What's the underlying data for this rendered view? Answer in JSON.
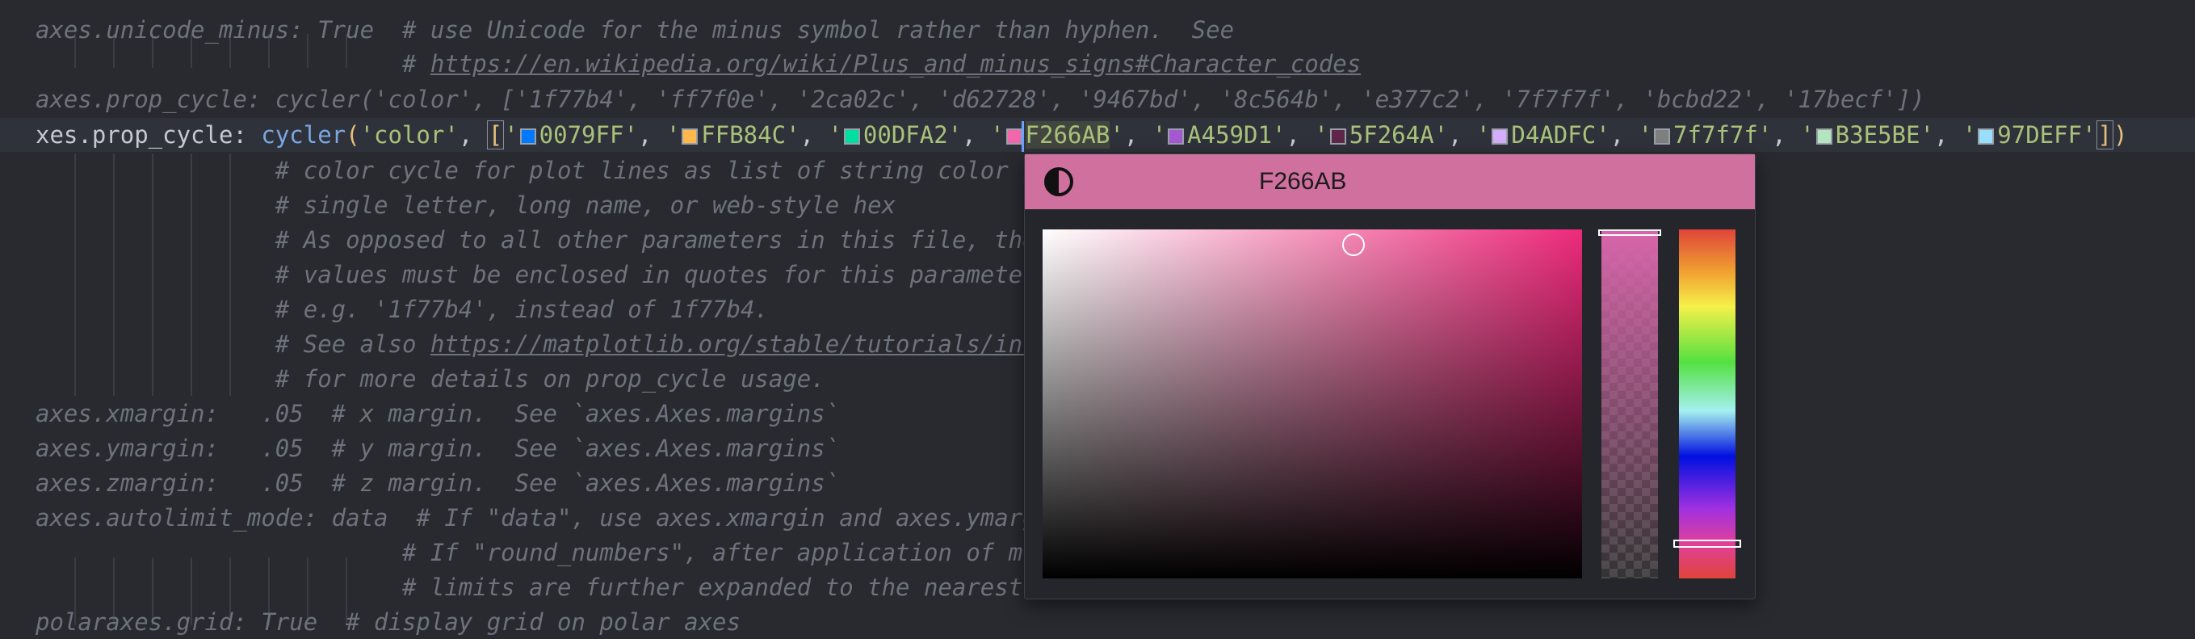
{
  "code_lines": [
    "axes.unicode_minus: True  # use Unicode for the minus symbol rather than hyphen.  See",
    "                          # https://en.wikipedia.org/wiki/Plus_and_minus_signs#Character_codes",
    "axes.prop_cycle: cycler('color', ['1f77b4', 'ff7f0e', '2ca02c', 'd62728', '9467bd', '8c564b', 'e377c2', '7f7f7f', 'bcbd22', '17becf'])",
    "",
    "                 # color cycle for plot lines as list of string color s",
    "                 # single letter, long name, or web-style hex",
    "                 # As opposed to all other parameters in this file, the",
    "                 # values must be enclosed in quotes for this parameter",
    "                 # e.g. '1f77b4', instead of 1f77b4.",
    "                 # See also https://matplotlib.org/stable/tutorials/int",
    "                 # for more details on prop_cycle usage.",
    "axes.xmargin:   .05  # x margin.  See `axes.Axes.margins`",
    "axes.ymargin:   .05  # y margin.  See `axes.Axes.margins`",
    "axes.zmargin:   .05  # z margin.  See `axes.Axes.margins`",
    "axes.autolimit_mode: data  # If \"data\", use axes.xmargin and axes.ymarg",
    "                          # If \"round_numbers\", after application of m",
    "                          # limits are further expanded to the nearest",
    "polaraxes.grid: True  # display grid on polar axes"
  ],
  "active_line": {
    "key": "xes.prop_cycle",
    "fn": "cycler",
    "first_arg": "'color'",
    "colors": [
      {
        "hex": "0079FF",
        "swatch": "#0079FF"
      },
      {
        "hex": "FFB84C",
        "swatch": "#FFB84C"
      },
      {
        "hex": "00DFA2",
        "swatch": "#00DFA2"
      },
      {
        "hex": "F266AB",
        "swatch": "#F266AB"
      },
      {
        "hex": "A459D1",
        "swatch": "#A459D1"
      },
      {
        "hex": "5F264A",
        "swatch": "#5F264A"
      },
      {
        "hex": "D4ADFC",
        "swatch": "#D4ADFC"
      },
      {
        "hex": "7f7f7f",
        "swatch": "#7f7f7f"
      },
      {
        "hex": "B3E5BE",
        "swatch": "#B3E5BE"
      },
      {
        "hex": "97DEFF",
        "swatch": "#97DEFF"
      }
    ]
  },
  "color_picker": {
    "hex_value": "F266AB",
    "header_color": "#d0709f"
  }
}
